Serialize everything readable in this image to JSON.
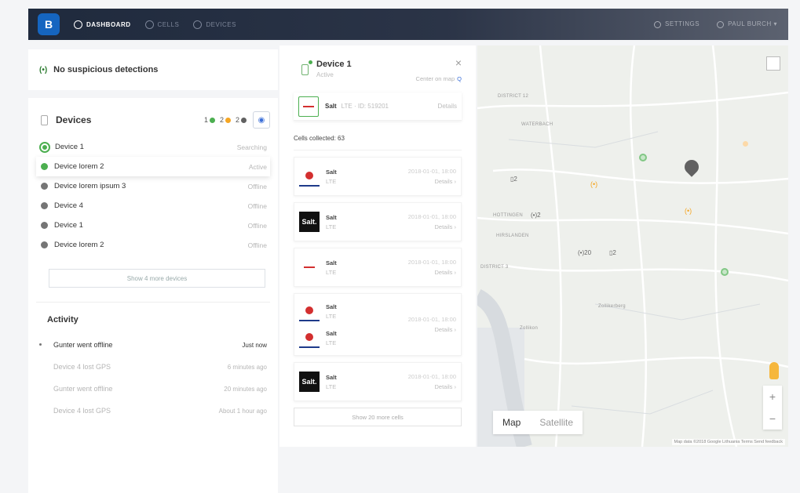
{
  "nav": {
    "logo": "B",
    "items": [
      {
        "label": "DASHBOARD",
        "icon": "dashboard-icon",
        "active": true
      },
      {
        "label": "CELLS",
        "icon": "cells-icon",
        "active": false
      },
      {
        "label": "DEVICES",
        "icon": "devices-icon",
        "active": false
      }
    ],
    "settings": "SETTINGS",
    "user": "PAUL BURCH"
  },
  "alert": {
    "icon": "(•)",
    "text": "No suspicious detections"
  },
  "devices": {
    "title": "Devices",
    "counts": [
      {
        "value": "1",
        "color": "#4caf50"
      },
      {
        "value": "2",
        "color": "#f5a623"
      },
      {
        "value": "2",
        "color": "#616161"
      }
    ],
    "list": [
      {
        "name": "Device 1",
        "status": "Searching",
        "color": "#4caf50"
      },
      {
        "name": "Device lorem 2",
        "status": "Active",
        "color": "#4caf50"
      },
      {
        "name": "Device lorem ipsum 3",
        "status": "Offline",
        "color": "#757575"
      },
      {
        "name": "Device 4",
        "status": "Offline",
        "color": "#757575"
      },
      {
        "name": "Device 1",
        "status": "Offline",
        "color": "#757575"
      },
      {
        "name": "Device lorem 2",
        "status": "Offline",
        "color": "#757575"
      }
    ],
    "show_more": "Show 4 more devices"
  },
  "activity": {
    "title": "Activity",
    "items": [
      {
        "text": "Gunter went offline",
        "time": "Just now"
      },
      {
        "text": "Device 4 lost GPS",
        "time": "6 minutes ago"
      },
      {
        "text": "Gunter went offline",
        "time": "20 minutes ago"
      },
      {
        "text": "Device 4 lost GPS",
        "time": "About 1 hour ago"
      }
    ]
  },
  "detail": {
    "name": "Device 1",
    "status": "Active",
    "close": "×",
    "center_on_map": "Center on map",
    "current_cell": {
      "name": "Salt",
      "meta": "LTE · ID: 519201",
      "details": "Details"
    },
    "cells_collected": "Cells collected: 63",
    "cells": [
      {
        "name": "Salt",
        "tech": "LTE",
        "date": "2018-01-01, 18:00",
        "details": "Details ›",
        "logo": "swisscom"
      },
      {
        "name": "Salt",
        "tech": "LTE",
        "date": "2018-01-01, 18:00",
        "details": "Details ›",
        "logo": "salt",
        "logo_text": "Salt."
      },
      {
        "name": "Salt",
        "tech": "LTE",
        "date": "2018-01-01, 18:00",
        "details": "Details ›",
        "logo": "sunrise"
      },
      {
        "name": "Salt",
        "tech": "LTE",
        "date": "2018-01-01, 18:00",
        "details": "Details ›",
        "logo": "salt",
        "logo_text": "Salt."
      }
    ],
    "multi_cell": {
      "rows": [
        {
          "name": "Salt",
          "tech": "LTE"
        },
        {
          "name": "Salt",
          "tech": "LTE"
        }
      ],
      "date": "2018-01-01, 18:00",
      "details": "Details ›"
    },
    "show_more": "Show 20 more cells"
  },
  "map": {
    "tabs": [
      "Map",
      "Satellite"
    ],
    "labels": [
      "DISTRICT 12",
      "WATERBACH",
      "DISTRICT 3",
      "Zollikon",
      "HOTTINGEN",
      "HIRSLANDEN",
      "Zollikerberg"
    ],
    "markers": [
      {
        "kind": "pin",
        "color": "#616161"
      },
      {
        "kind": "signal",
        "color": "#f5a623"
      },
      {
        "kind": "device",
        "color": "#4caf50"
      }
    ],
    "clusters": [
      "2",
      "2",
      "20",
      "2"
    ],
    "attribution": "Map data ©2018 Google  Lithuania  Terms  Send feedback"
  }
}
